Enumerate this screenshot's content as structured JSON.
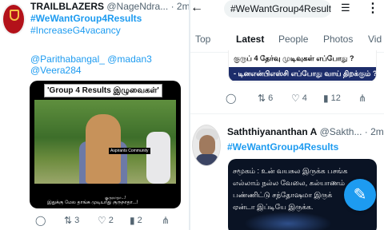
{
  "left_tweet": {
    "display_name": "TRAILBLAZERS",
    "handle": "@NageNdra...",
    "time": "· 2m",
    "hashtag1": "#WeWantGroup4Results",
    "hashtag2": "#IncreaseG4vacancy",
    "mentions_line1": "@Parithabangal_ @madan3",
    "mentions_line2": "@Veera284",
    "meme_title": "'Group 4 Results இழுவைகள்'",
    "meme_watermark": "Aspirants Community",
    "meme_caption_small": "குருநாதா...!",
    "meme_caption": "இதுக்கு மேல தாங்க முடியாது குருநாதா...!",
    "actions": {
      "reply": "",
      "retweet": "3",
      "like": "2",
      "views": "2"
    }
  },
  "right_pane": {
    "search_value": "#WeWantGroup4Results",
    "tabs": [
      "Top",
      "Latest",
      "People",
      "Photos",
      "Vid"
    ],
    "active_tab": "Latest",
    "first_tweet": {
      "image_line1": "குருப் 4 தேர்வு முடிவுகள் எப்போது ?",
      "image_line2": "- டினஎன்பிஎஸ்சி எப்போது வாய் திறக்கும் ?",
      "actions": {
        "reply": "",
        "retweet": "6",
        "like": "4",
        "views": "12"
      }
    },
    "second_tweet": {
      "display_name": "Saththiyananthan A",
      "handle": "@Sakth...",
      "time": "· 2m",
      "hashtag": "#WeWantGroup4Results",
      "image_lines": [
        "சமூகம் : உன் வயசுல இருக்க பசங்க",
        "எல்லாம் நல்ல வேலை, கல்யாணம்",
        "பண்ணிட்டு சந்தோஷமா இருக்",
        "ஏன்டா இப்டியே இருக்க."
      ]
    }
  },
  "colors": {
    "link": "#1d9bf0",
    "text": "#0f1419",
    "muted": "#536471"
  }
}
